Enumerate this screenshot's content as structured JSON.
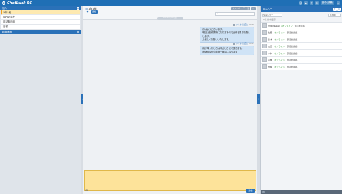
{
  "app": {
    "name": "ChatLuck 5C",
    "user_name": "田中(部署)"
  },
  "sidebar": {
    "section1_title": "個人",
    "rooms": [
      "1年1組",
      "JAPAN学校",
      "部活動連絡",
      "旧校"
    ],
    "section2_title": "組織連絡"
  },
  "chat": {
    "room_title": "1年1組",
    "room_info_button": "連絡",
    "header_buttons": [
      "＋メンバー",
      "一覧"
    ],
    "search_placeholder": "",
    "date_label": "2019/10/26 (土)",
    "messages": [
      {
        "reply_label": "からから返信",
        "time": "10:48",
        "lines": [
          "おはようございます。",
          "明日は部作業所になりますので出来る限りお願いします。",
          "よろしくお願いいたします。"
        ]
      },
      {
        "reply_label": "からから返信",
        "time": "10:52",
        "lines": [
          "雨が降ったときは中止とさせて頂きます。",
          "連絡事項が今年度一番中になります"
        ]
      }
    ],
    "send_label": "送信"
  },
  "members": {
    "title": "メンバー",
    "filter_all": "全メンバー",
    "filter_sort": "名前順",
    "count_label": "0名(全)の表示",
    "list": [
      {
        "name": "田中(部署長)",
        "status": "(オンライン)",
        "org": "部活動連絡"
      },
      {
        "name": "佐藤",
        "status": "(オンライン)",
        "org": "部活動連絡"
      },
      {
        "name": "鈴木",
        "status": "(オンライン)",
        "org": "部活動連絡"
      },
      {
        "name": "山田",
        "status": "(オンライン)",
        "org": "部活動連絡"
      },
      {
        "name": "小林",
        "status": "(オンライン)",
        "org": "部活動連絡"
      },
      {
        "name": "高橋",
        "status": "(オンライン)",
        "org": "部活動連絡"
      },
      {
        "name": "伊藤",
        "status": "(オンライン)",
        "org": "部活動連絡"
      }
    ]
  },
  "colors": {
    "brand": "#1f6fb5",
    "input_bg": "#fde39a",
    "bubble": "#cfe3f6"
  }
}
